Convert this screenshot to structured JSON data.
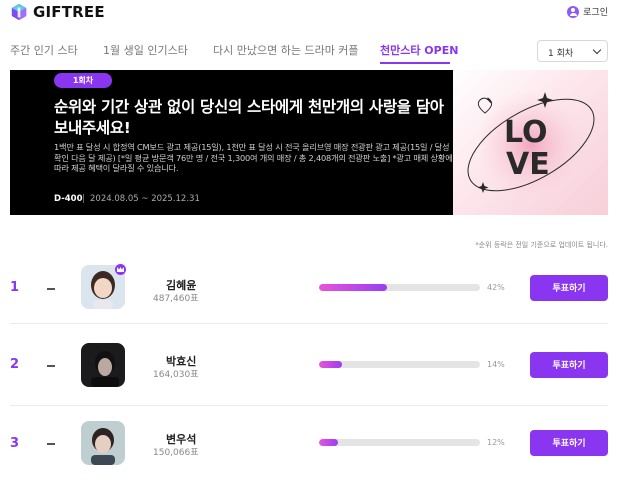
{
  "header": {
    "logo_text": "GIFTREE",
    "login_label": "로그인"
  },
  "tabs": [
    {
      "label": "주간 인기 스타"
    },
    {
      "label": "1월 생일 인기스타"
    },
    {
      "label": "다시 만났으면 하는 드라마 커플"
    },
    {
      "label": "천만스타 OPEN",
      "active": true
    }
  ],
  "round_select": {
    "value": "1 회차"
  },
  "banner": {
    "badge": "1회차",
    "title": "순위와 기간 상관 없이 당신의 스타에게 천만개의 사랑을 담아 보내주세요!",
    "description": "1백만 표 달성 시 합정역 CM보드 광고 제공(15일), 1천만 표 달성 시 전국 올리브영 매장 전광판 광고 제공(15일 / 달성 확인 다음 달 제공) [*일 평균 방문객 76만 명 / 전국 1,300여 개의 매장 / 총 2,408개의 전광판 노출] *광고 매체 상황에 따라 제공 혜택이 달라질 수 있습니다.",
    "dday": "D-400",
    "period": "2024.08.05 ~ 2025.12.31",
    "art_text": "LOVE"
  },
  "notice": "*순위 등락은 전일 기준으로 업데이트 됩니다.",
  "rankings": [
    {
      "rank": "1",
      "name": "김혜윤",
      "votes": "487,460표",
      "percent_label": "42%",
      "percent": 0.42,
      "button": "투표하기"
    },
    {
      "rank": "2",
      "name": "박효신",
      "votes": "164,030표",
      "percent_label": "14%",
      "percent": 0.14,
      "button": "투표하기"
    },
    {
      "rank": "3",
      "name": "변우석",
      "votes": "150,066표",
      "percent_label": "12%",
      "percent": 0.12,
      "button": "투표하기"
    }
  ],
  "colors": {
    "accent": "#8a36f0",
    "bar_start": "#e655d8",
    "bar_end": "#9a3ef2",
    "banner_bg": "#000000"
  }
}
